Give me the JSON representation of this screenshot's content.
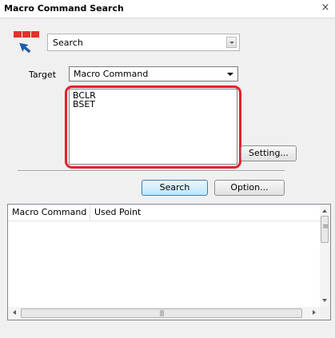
{
  "window": {
    "title": "Macro Command Search",
    "close_icon": "close-icon"
  },
  "search_mode": {
    "icon": "macro-search-icon",
    "value": "Search"
  },
  "target": {
    "label": "Target",
    "value": "Macro Command"
  },
  "commands": [
    "BCLR",
    "BSET"
  ],
  "buttons": {
    "setting": "Setting...",
    "search": "Search",
    "option": "Option..."
  },
  "results": {
    "columns": [
      "Macro Command",
      "Used Point"
    ],
    "rows": []
  },
  "colors": {
    "highlight": "#e8202a",
    "logo_red": "#e8302a",
    "logo_arrow": "#1f5fa8"
  }
}
